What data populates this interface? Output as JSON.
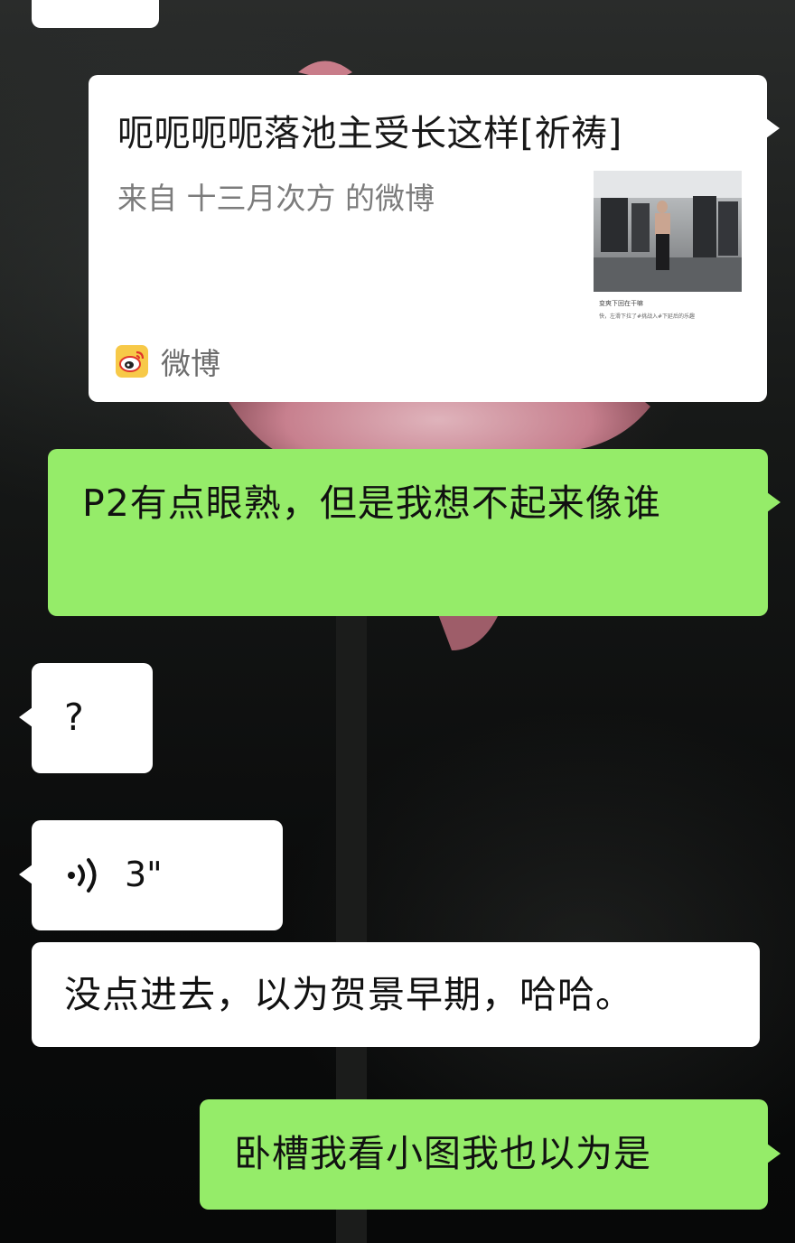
{
  "messages": {
    "card": {
      "title": "呃呃呃呃落池主受长这样[祈祷]",
      "subtitle": "来自 十三月次方 的微博",
      "thumbnail_caption_1": "变爽下回在干嘛",
      "thumbnail_caption_2": "快，左滑下拉了#挑战入#下延后的乐趣",
      "source_label": "微博",
      "source_icon": "weibo-icon"
    },
    "sent_1": "P2有点眼熟，但是我想不起来像谁",
    "received_1": "?",
    "voice": {
      "duration": "3\"",
      "icon": "voice-wave-icon"
    },
    "received_2": "没点进去，以为贺景早期，哈哈。",
    "sent_2": "卧槽我看小图我也以为是"
  },
  "colors": {
    "sent_bubble": "#95ec69",
    "received_bubble": "#ffffff",
    "weibo_brand": "#f7c948"
  }
}
